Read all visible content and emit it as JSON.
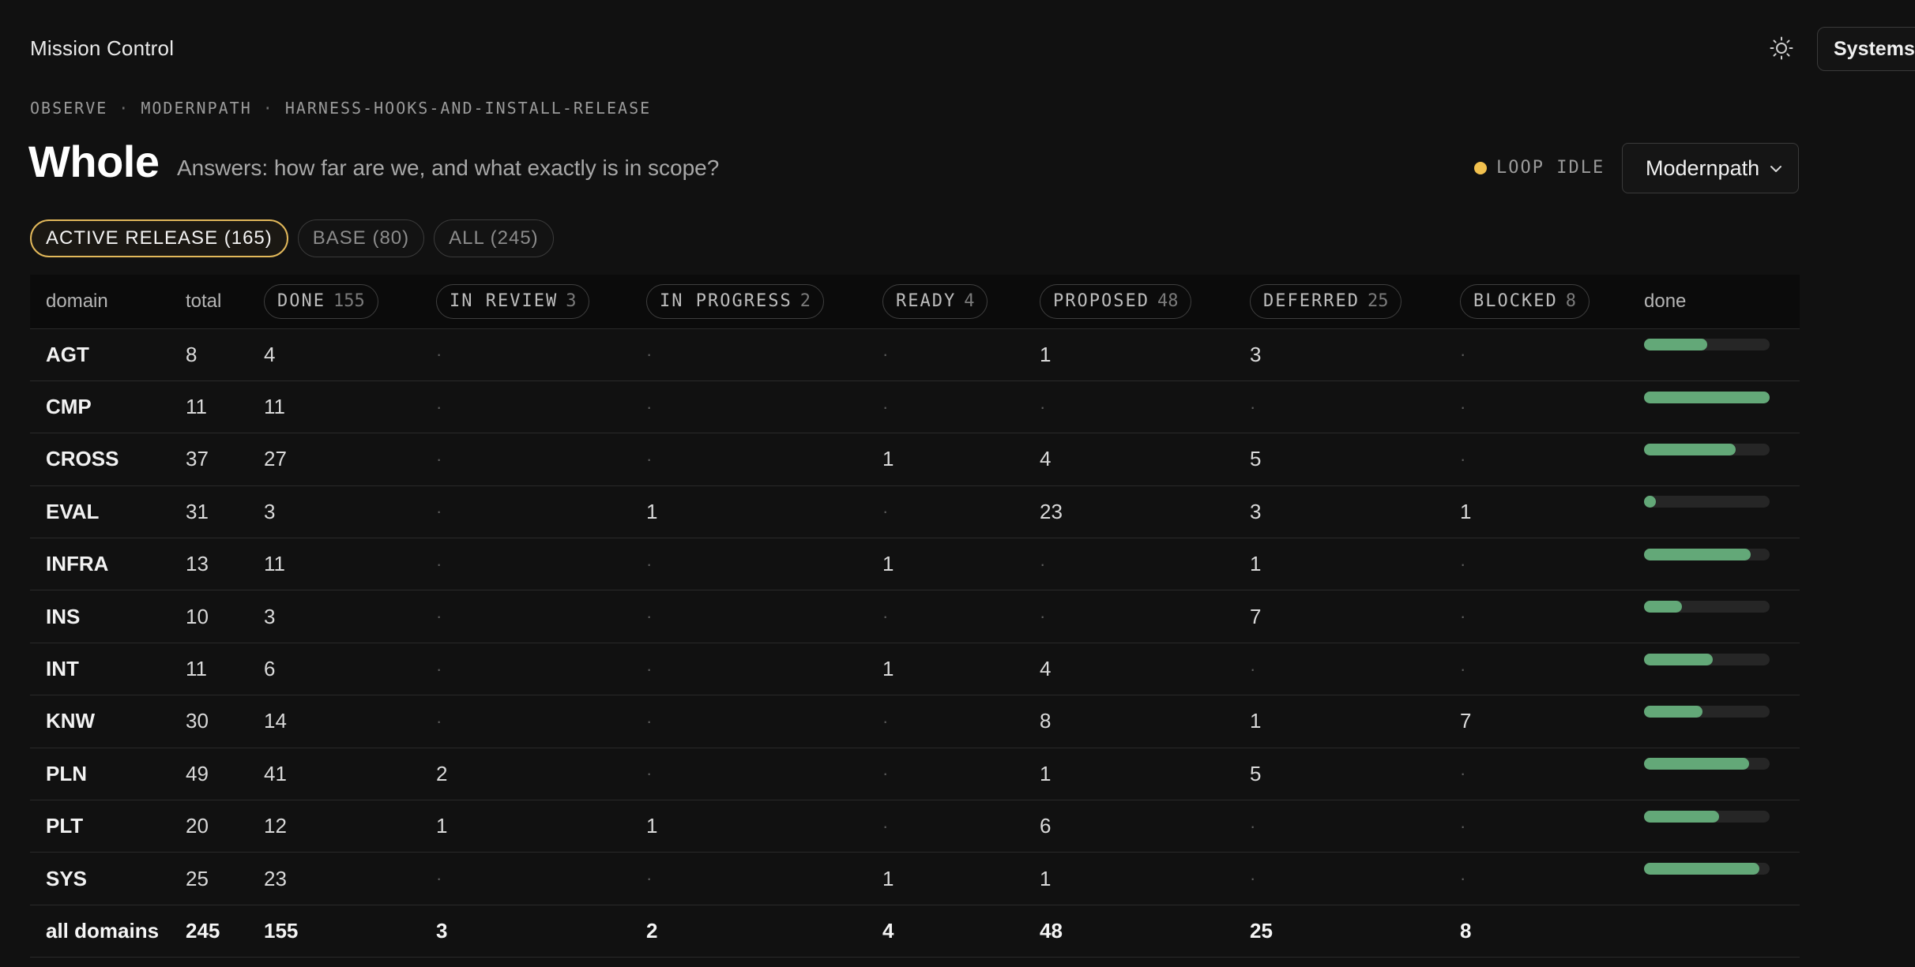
{
  "app": {
    "title": "Mission Control",
    "systems_label": "Systems"
  },
  "icons": {
    "theme_toggle": "sun-icon",
    "select_caret": "chevron-down-icon"
  },
  "colors": {
    "accent_pill": "#e2b85a",
    "status_idle": "#f2c14e",
    "bar_fill": "#63a878",
    "bar_track": "#262626"
  },
  "breadcrumb": [
    "OBSERVE",
    "MODERNPATH",
    "HARNESS-HOOKS-AND-INSTALL-RELEASE"
  ],
  "breadcrumb_sep": "·",
  "page": {
    "title": "Whole",
    "subtitle": "Answers: how far are we, and what exactly is in scope?",
    "loop_status": "LOOP IDLE",
    "project": "Modernpath"
  },
  "filters": [
    {
      "label": "ACTIVE RELEASE (165)",
      "active": true
    },
    {
      "label": "BASE (80)",
      "active": false
    },
    {
      "label": "ALL (245)",
      "active": false
    }
  ],
  "table": {
    "headers": {
      "domain": "domain",
      "total": "total",
      "done_bar": "done"
    },
    "status_columns": [
      {
        "label": "DONE",
        "count": "155"
      },
      {
        "label": "IN REVIEW",
        "count": "3"
      },
      {
        "label": "IN PROGRESS",
        "count": "2"
      },
      {
        "label": "READY",
        "count": "4"
      },
      {
        "label": "PROPOSED",
        "count": "48"
      },
      {
        "label": "DEFERRED",
        "count": "25"
      },
      {
        "label": "BLOCKED",
        "count": "8"
      }
    ],
    "empty_symbol": "·",
    "rows": [
      {
        "domain": "AGT",
        "total": "8",
        "cells": [
          "4",
          "·",
          "·",
          "·",
          "1",
          "3",
          "·"
        ],
        "done_fraction": 0.5
      },
      {
        "domain": "CMP",
        "total": "11",
        "cells": [
          "11",
          "·",
          "·",
          "·",
          "·",
          "·",
          "·"
        ],
        "done_fraction": 1.0
      },
      {
        "domain": "CROSS",
        "total": "37",
        "cells": [
          "27",
          "·",
          "·",
          "1",
          "4",
          "5",
          "·"
        ],
        "done_fraction": 0.73
      },
      {
        "domain": "EVAL",
        "total": "31",
        "cells": [
          "3",
          "·",
          "1",
          "·",
          "23",
          "3",
          "1"
        ],
        "done_fraction": 0.097
      },
      {
        "domain": "INFRA",
        "total": "13",
        "cells": [
          "11",
          "·",
          "·",
          "1",
          "·",
          "1",
          "·"
        ],
        "done_fraction": 0.846
      },
      {
        "domain": "INS",
        "total": "10",
        "cells": [
          "3",
          "·",
          "·",
          "·",
          "·",
          "7",
          "·"
        ],
        "done_fraction": 0.3
      },
      {
        "domain": "INT",
        "total": "11",
        "cells": [
          "6",
          "·",
          "·",
          "1",
          "4",
          "·",
          "·"
        ],
        "done_fraction": 0.545
      },
      {
        "domain": "KNW",
        "total": "30",
        "cells": [
          "14",
          "·",
          "·",
          "·",
          "8",
          "1",
          "7"
        ],
        "done_fraction": 0.467
      },
      {
        "domain": "PLN",
        "total": "49",
        "cells": [
          "41",
          "2",
          "·",
          "·",
          "1",
          "5",
          "·"
        ],
        "done_fraction": 0.837
      },
      {
        "domain": "PLT",
        "total": "20",
        "cells": [
          "12",
          "1",
          "1",
          "·",
          "6",
          "·",
          "·"
        ],
        "done_fraction": 0.6
      },
      {
        "domain": "SYS",
        "total": "25",
        "cells": [
          "23",
          "·",
          "·",
          "1",
          "1",
          "·",
          "·"
        ],
        "done_fraction": 0.92
      }
    ],
    "totals": {
      "domain": "all domains",
      "total": "245",
      "cells": [
        "155",
        "3",
        "2",
        "4",
        "48",
        "25",
        "8"
      ]
    }
  }
}
